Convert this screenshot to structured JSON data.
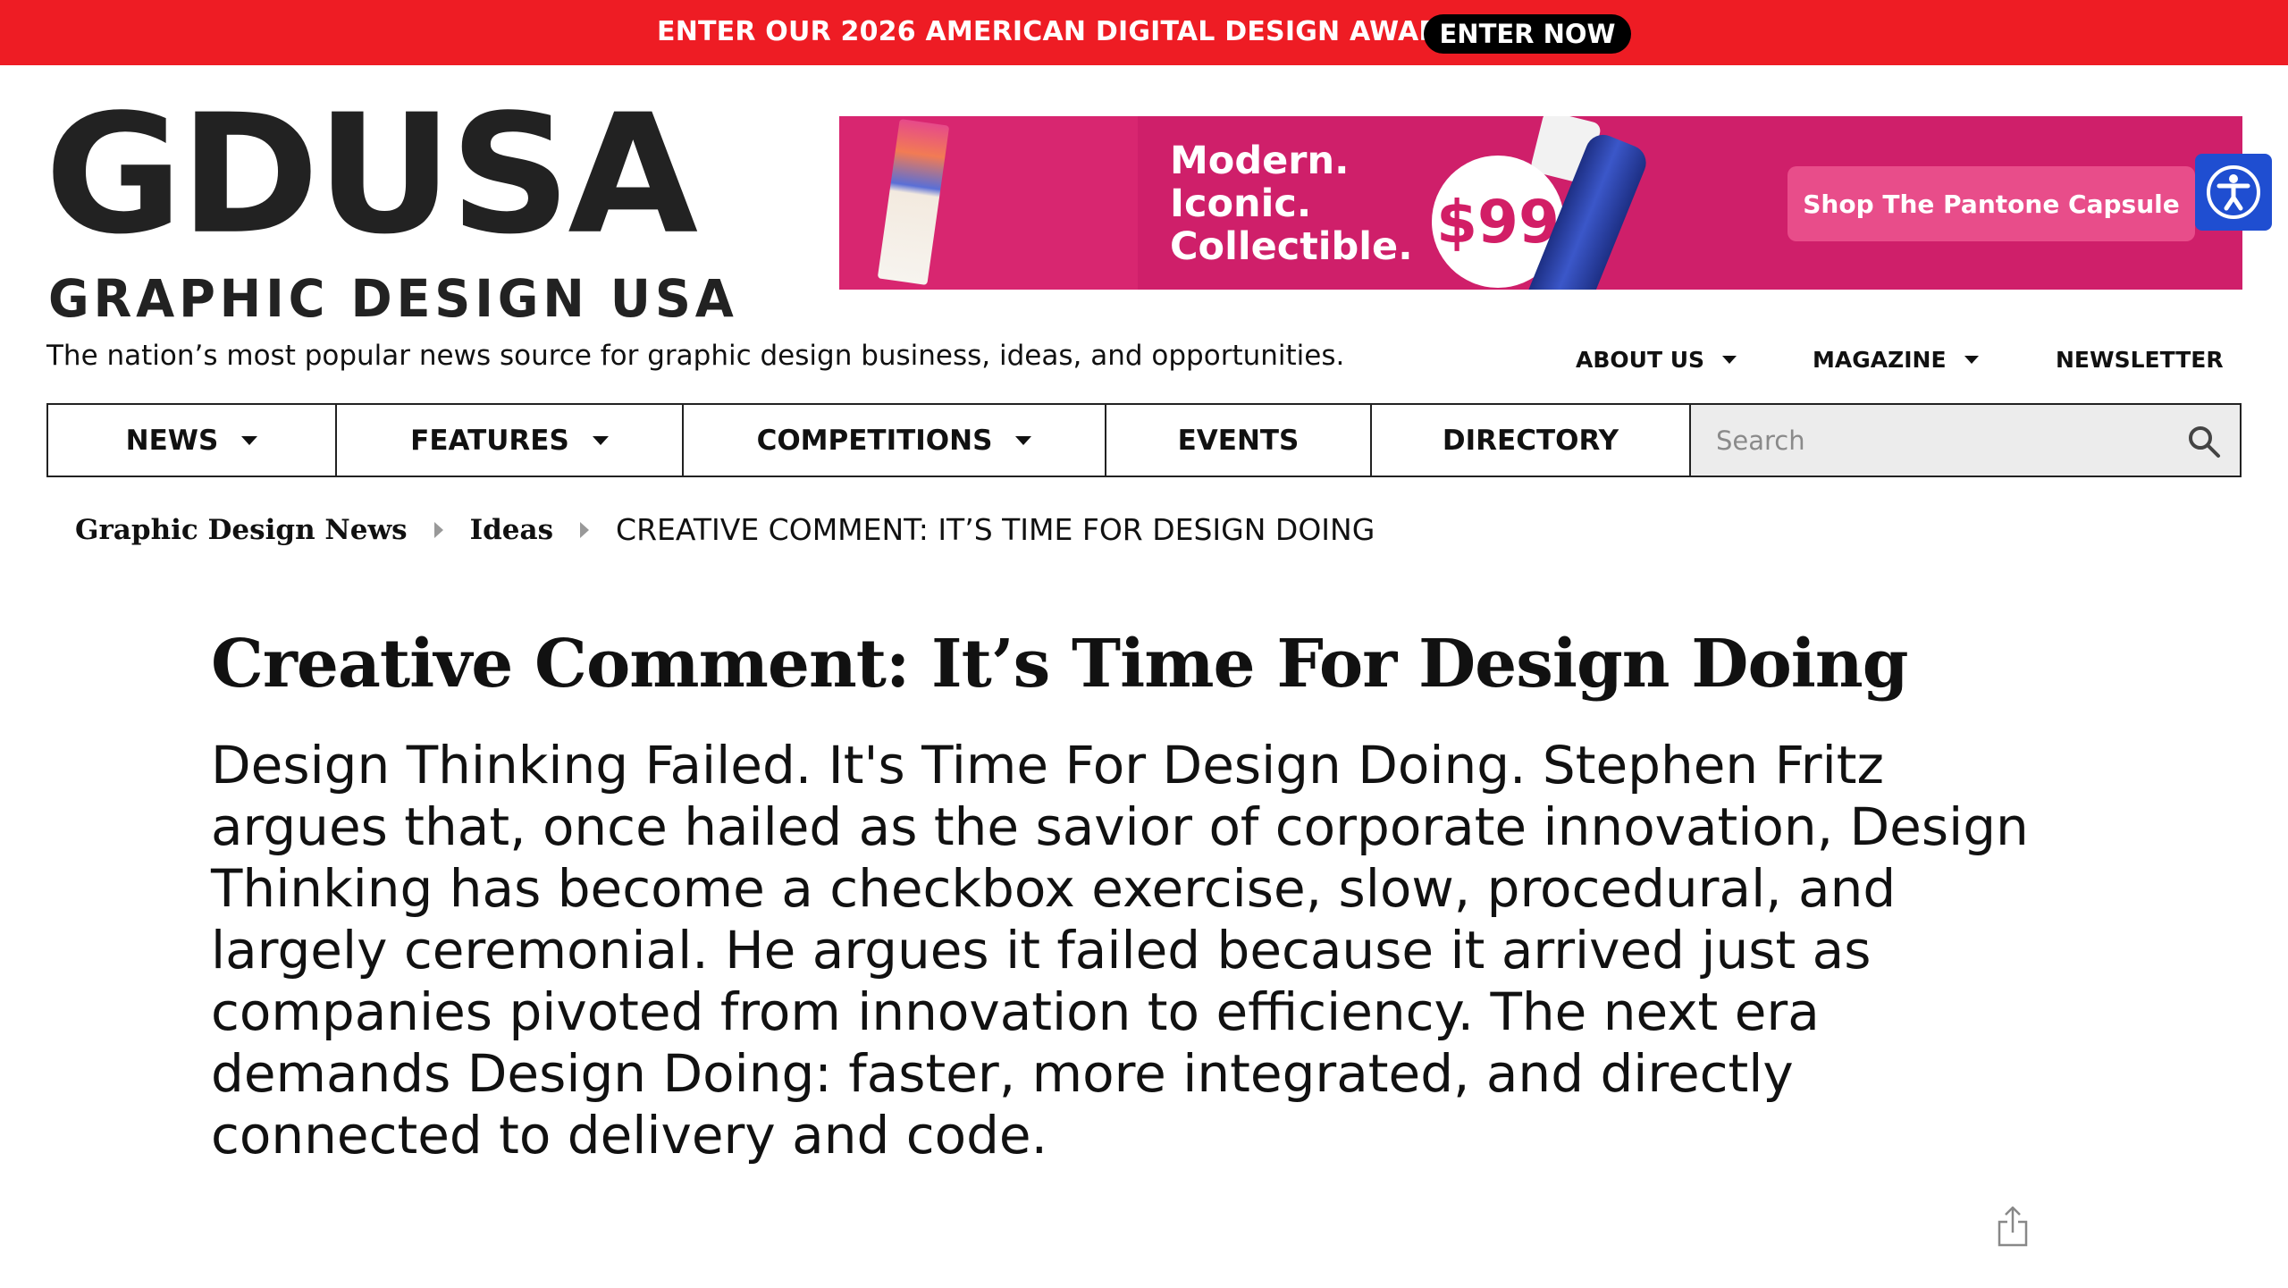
{
  "promo": {
    "text": "ENTER OUR 2026 AMERICAN DIGITAL DESIGN AWARDS™",
    "button_label": "ENTER NOW",
    "background_color": "#ee1c24"
  },
  "logo": {
    "main": "GDUSA",
    "sub": "GRAPHIC DESIGN USA"
  },
  "tagline": "The nation’s most popular news source for graphic design business, ideas, and opportunities.",
  "ad": {
    "headline_lines": [
      "Modern.",
      "Iconic.",
      "Collectible."
    ],
    "price": "$99",
    "cta_label": "Shop The Pantone Capsule",
    "background_color": "#cf1f6a"
  },
  "accessibility": {
    "icon": "accessibility-icon",
    "color": "#1f4ed1"
  },
  "secondary_nav": [
    {
      "label": "ABOUT US",
      "has_dropdown": true
    },
    {
      "label": "MAGAZINE",
      "has_dropdown": true
    },
    {
      "label": "NEWSLETTER",
      "has_dropdown": false
    }
  ],
  "main_nav": [
    {
      "label": "NEWS",
      "has_dropdown": true
    },
    {
      "label": "FEATURES",
      "has_dropdown": true
    },
    {
      "label": "COMPETITIONS",
      "has_dropdown": true
    },
    {
      "label": "EVENTS",
      "has_dropdown": false
    },
    {
      "label": "DIRECTORY",
      "has_dropdown": false
    }
  ],
  "search": {
    "placeholder": "Search",
    "icon": "search-icon"
  },
  "breadcrumb": {
    "items": [
      "Graphic Design News",
      "Ideas"
    ],
    "current": "CREATIVE COMMENT: IT’S TIME FOR DESIGN DOING"
  },
  "article": {
    "title": "Creative Comment: It’s Time For Design Doing",
    "dek": "Design Thinking Failed. It's Time For Design Doing. Stephen Fritz argues that, once hailed as the savior of corporate innovation, Design Thinking has become a checkbox exercise, slow, procedural, and largely ceremonial. He argues it failed because it arrived just as companies pivoted from innovation to efficiency. The next era demands Design Doing: faster, more integrated, and directly connected to delivery and code."
  },
  "share": {
    "icon": "share-icon"
  }
}
